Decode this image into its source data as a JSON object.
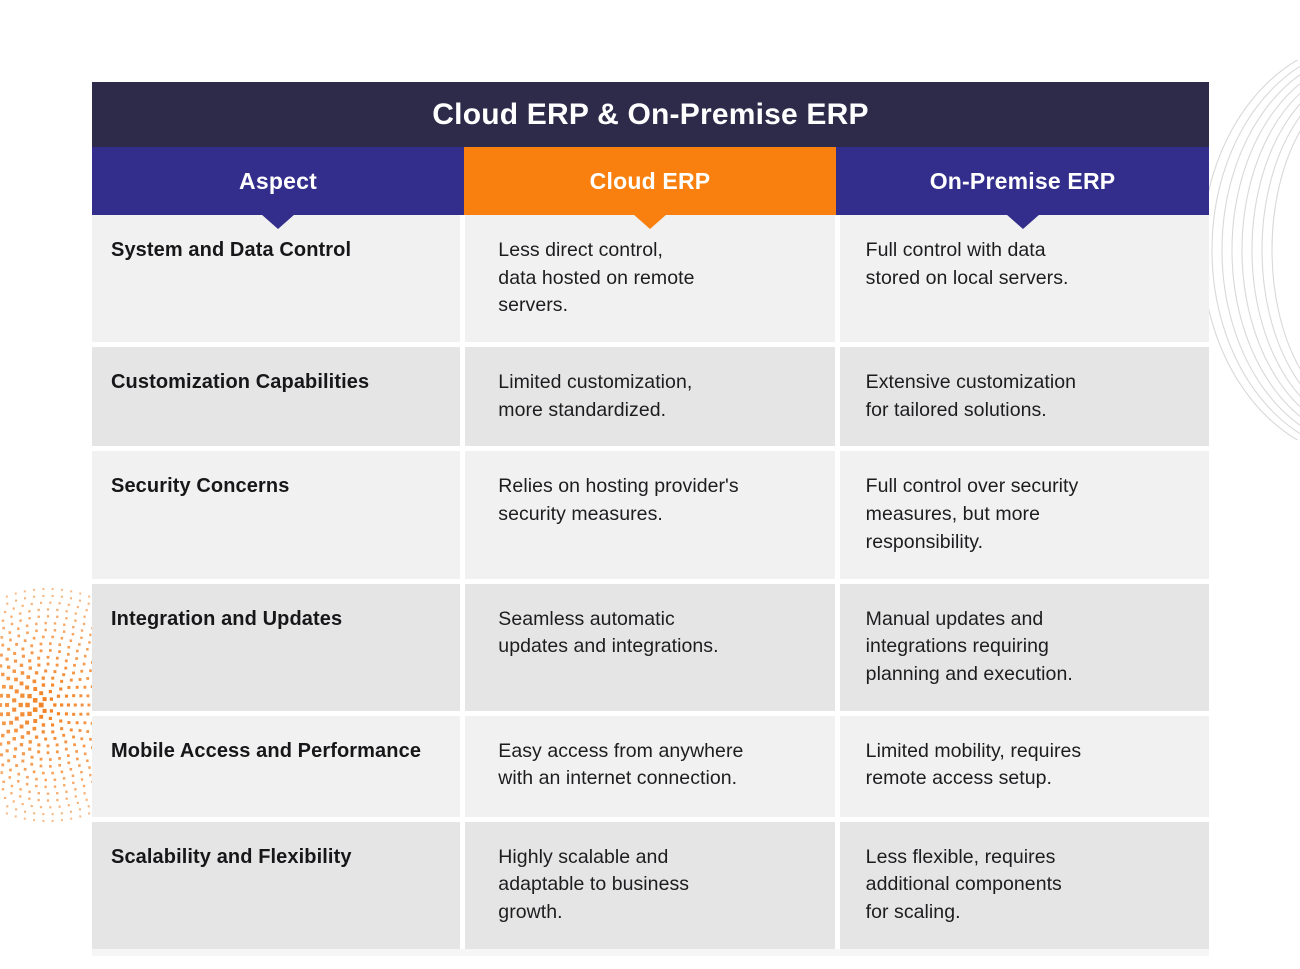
{
  "title": "Cloud ERP & On-Premise ERP",
  "colors": {
    "title_bar": "#2d2a4a",
    "header_purple": "#332e8c",
    "header_orange": "#f9800f",
    "row_light": "#f1f1f1",
    "row_dark": "#e5e5e5",
    "text_dark": "#17171a",
    "dots_orange": "#f28020",
    "arcs_gray": "#d8d8d8"
  },
  "columns": [
    {
      "label": "Aspect",
      "accent": "#332e8c"
    },
    {
      "label": "Cloud ERP",
      "accent": "#f9800f"
    },
    {
      "label": "On-Premise ERP",
      "accent": "#332e8c"
    }
  ],
  "rows": [
    {
      "aspect": "System and Data Control",
      "cloud": "Less direct control,\ndata hosted on remote\nservers.",
      "onprem": "Full control with data\nstored on local servers."
    },
    {
      "aspect": "Customization Capabilities",
      "cloud": "Limited customization,\nmore standardized.",
      "onprem": "Extensive customization\nfor tailored solutions."
    },
    {
      "aspect": "Security Concerns",
      "cloud": "Relies on hosting provider's\nsecurity measures.",
      "onprem": "Full control over security\nmeasures, but more\nresponsibility."
    },
    {
      "aspect": "Integration and Updates",
      "cloud": "Seamless automatic\nupdates and integrations.",
      "onprem": "Manual updates and\nintegrations requiring\nplanning and execution."
    },
    {
      "aspect": "Mobile Access and\nPerformance",
      "cloud": "Easy access from anywhere\nwith an internet connection.",
      "onprem": "Limited mobility, requires\nremote access setup."
    },
    {
      "aspect": "Scalability and Flexibility",
      "cloud": "Highly scalable and\nadaptable to business\ngrowth.",
      "onprem": "Less flexible, requires\nadditional components\nfor scaling."
    }
  ]
}
